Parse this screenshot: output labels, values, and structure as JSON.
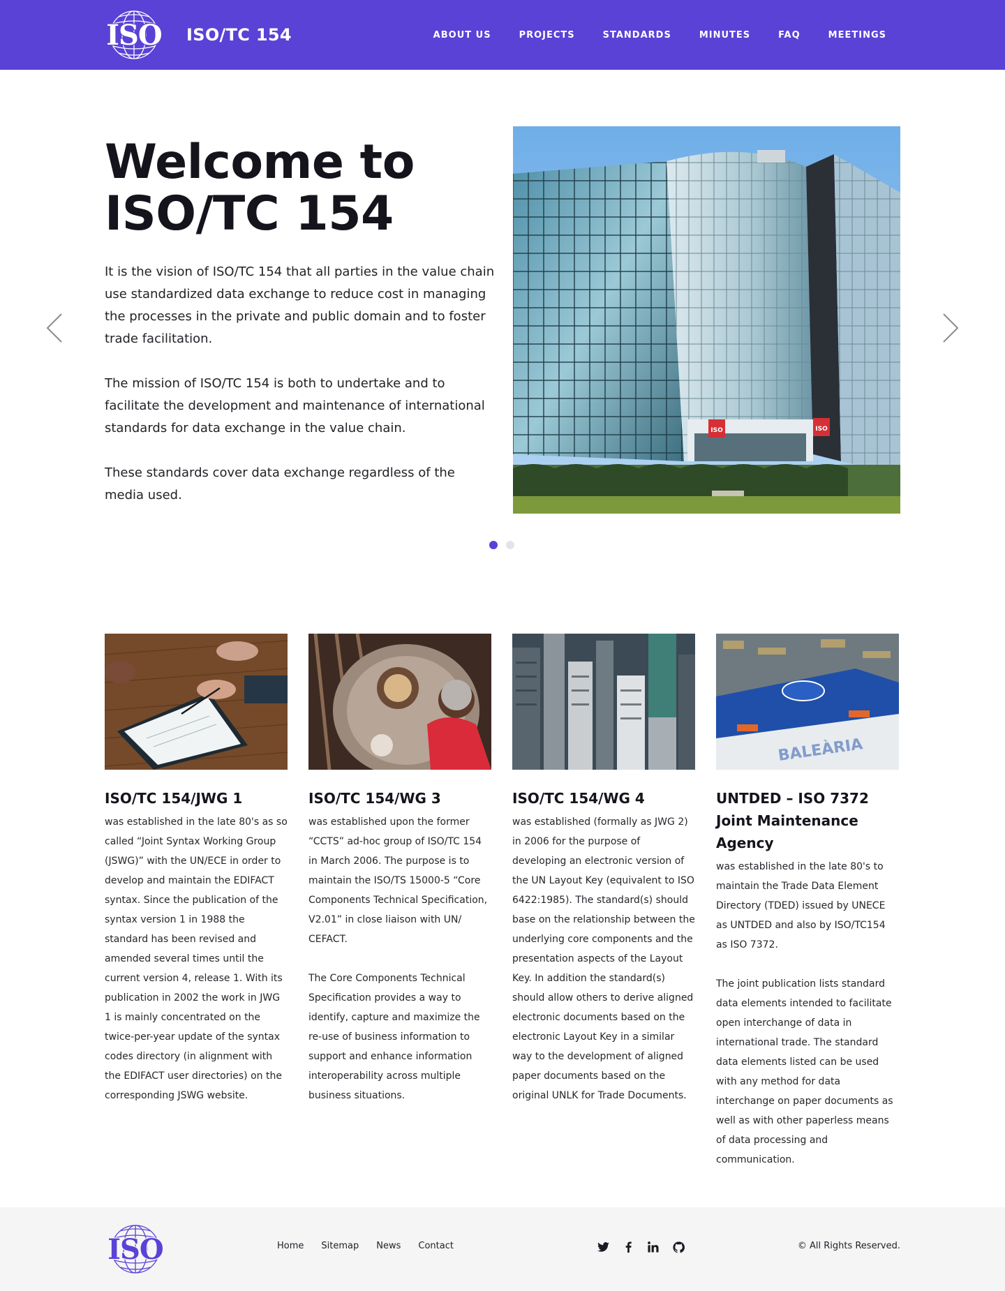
{
  "brand": {
    "logo_text": "ISO",
    "site_title": "ISO/TC 154",
    "accent_color": "#5a42d6"
  },
  "nav": {
    "items": [
      {
        "label": "ABOUT US"
      },
      {
        "label": "PROJECTS"
      },
      {
        "label": "STANDARDS"
      },
      {
        "label": "MINUTES"
      },
      {
        "label": "FAQ"
      },
      {
        "label": "MEETINGS"
      }
    ]
  },
  "hero": {
    "title_line1": "Welcome to",
    "title_line2": "ISO/TC 154",
    "paragraphs": [
      "It is the vision of ISO/TC 154 that all parties in the value chain use standardized data exchange to reduce cost in managing the processes in the private and public domain and to foster trade facilitation.",
      "The mission of ISO/TC 154 is both to undertake and to facilitate the development and maintenance of international standards for data exchange in the value chain.",
      "These standards cover data exchange regardless of the media used."
    ],
    "slides_total": 2,
    "active_slide": 1,
    "dot_active_color": "#5a42d6",
    "dot_inactive_color": "#e4e4e8",
    "building_badge_text": "ISO"
  },
  "cards": [
    {
      "title": "ISO/TC 154/JWG 1",
      "paragraphs": [
        "was established in the late 80's as so called “Joint Syntax Working Group (JSWG)” with the UN/ECE in order to develop and maintain the EDIFACT syntax. Since the publication of the syntax version 1 in 1988 the standard has been revised and amended several times until the current version 4, release 1. With its publication in 2002 the work in JWG 1 is mainly concentrated on the twice-per-year update of the syntax codes directory (in alignment with the EDIFACT user directories) on the corresponding JSWG website."
      ]
    },
    {
      "title": "ISO/TC 154/WG 3",
      "paragraphs": [
        "was established upon the former “CCTS” ad-hoc group of ISO/TC 154 in March 2006. The purpose is to maintain the ISO/TS 15000-5 “Core Components Technical Specification, V2.01” in close liaison with UN/ CEFACT.",
        "The Core Components Technical Specification provides a way to identify, capture and maximize the re-use of business information to support and enhance information interoperability across multiple business situations."
      ]
    },
    {
      "title": "ISO/TC 154/WG 4",
      "paragraphs": [
        "was established (formally as JWG 2) in 2006 for the purpose of developing an electronic version of the UN Layout Key (equivalent to ISO 6422:1985). The standard(s) should base on the relationship between the underlying core components and the presentation aspects of the Layout Key. In addition the standard(s) should allow others to derive aligned electronic documents based on the electronic Layout Key in a similar way to the development of aligned paper documents based on the original UNLK for Trade Documents."
      ]
    },
    {
      "title": "UNTDED – ISO 7372 Joint Maintenance Agency",
      "paragraphs": [
        "was established in the late 80's to maintain the Trade Data Element Directory (TDED) issued by UNECE as UNTDED and also by ISO/TC154 as ISO 7372.",
        "The joint publication lists standard data elements intended to facilitate open interchange of data in international trade. The standard data elements listed can be used with any method for data interchange on paper documents as well as with other paperless means of data processing and communication."
      ]
    }
  ],
  "card_images": [
    "tablet-signing-photo",
    "brewery-worker-photo",
    "city-skyscrapers-photo",
    "cargo-ship-photo"
  ],
  "footer": {
    "links": [
      {
        "label": "Home"
      },
      {
        "label": "Sitemap"
      },
      {
        "label": "News"
      },
      {
        "label": "Contact"
      }
    ],
    "social_icons": [
      "twitter-icon",
      "facebook-icon",
      "linkedin-icon",
      "github-icon"
    ],
    "copyright": "© All Rights Reserved."
  }
}
